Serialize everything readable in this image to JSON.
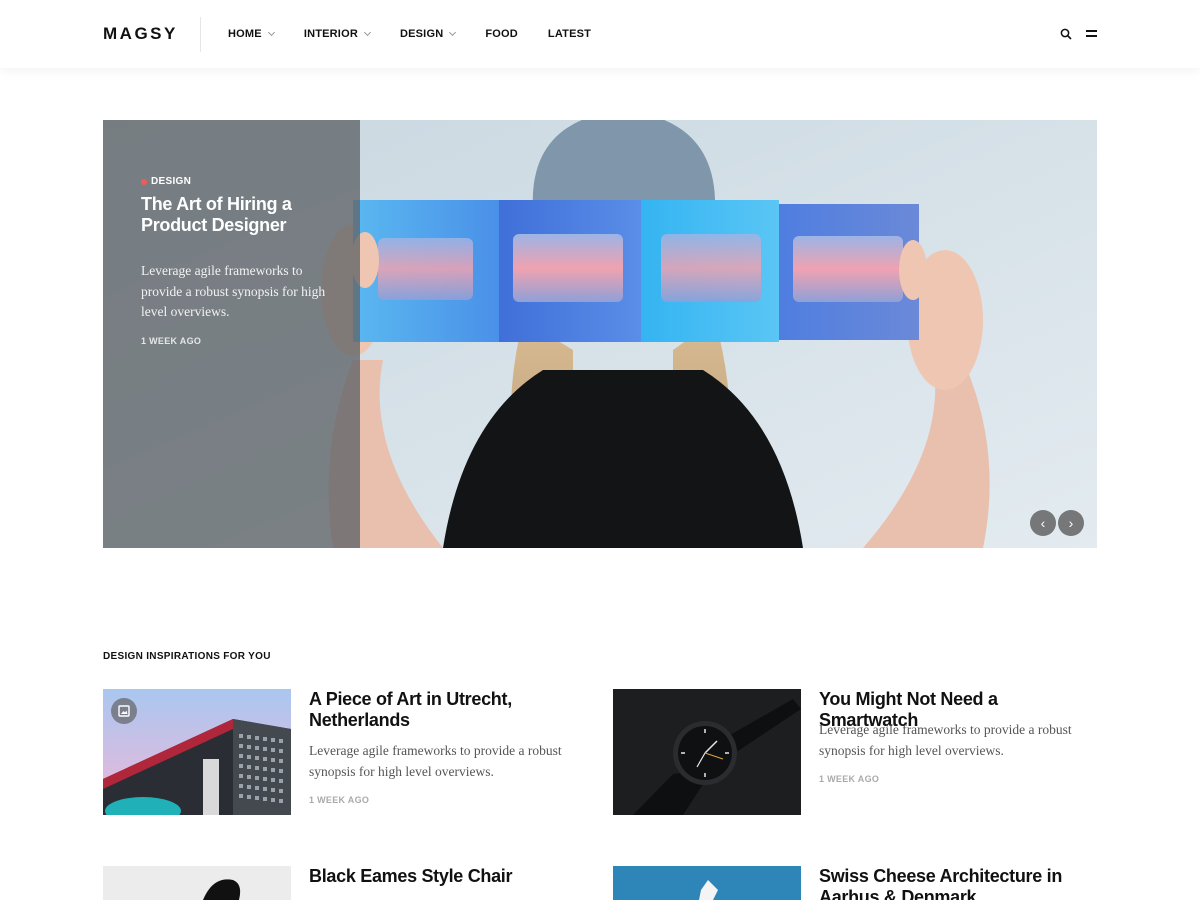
{
  "header": {
    "logo": "MAGSY",
    "nav": [
      {
        "label": "HOME",
        "dropdown": true
      },
      {
        "label": "INTERIOR",
        "dropdown": true
      },
      {
        "label": "DESIGN",
        "dropdown": true
      },
      {
        "label": "FOOD",
        "dropdown": false
      },
      {
        "label": "LATEST",
        "dropdown": false
      }
    ],
    "icons": [
      "search-icon",
      "menu-icon"
    ]
  },
  "hero": {
    "category": "DESIGN",
    "title": "The Art of Hiring a Product Designer",
    "excerpt": "Leverage agile frameworks to provide a robust synopsis for high level overviews.",
    "date": "1 WEEK AGO",
    "prev_glyph": "‹",
    "next_glyph": "›"
  },
  "section": {
    "title": "DESIGN INSPIRATIONS FOR YOU"
  },
  "posts": [
    {
      "title": "A Piece of Art in Utrecht, Netherlands",
      "excerpt": "Leverage agile frameworks to provide a robust synopsis for high level overviews.",
      "date": "1 WEEK AGO",
      "gallery": true
    },
    {
      "title": "You Might Not Need a Smartwatch",
      "excerpt": "Leverage agile frameworks to provide a robust synopsis for high level overviews.",
      "date": "1 WEEK AGO",
      "gallery": false
    },
    {
      "title": "Black Eames Style Chair",
      "gallery": false
    },
    {
      "title": "Swiss Cheese Architecture in Aarhus & Denmark",
      "gallery": false
    }
  ],
  "colors": {
    "accent_dot": "#ef5b5b",
    "text": "#111111",
    "muted": "#aaaaaa"
  }
}
